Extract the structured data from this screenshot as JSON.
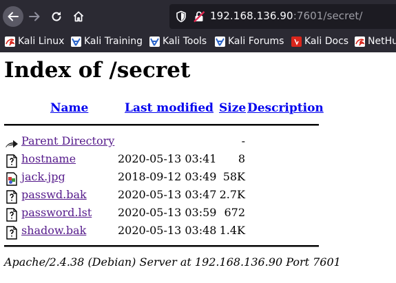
{
  "browser": {
    "url": {
      "host": "192.168.136.90",
      "rest": ":7601/secret/"
    },
    "bookmarks": [
      {
        "label": "Kali Linux",
        "icon": "kali-dragon-icon"
      },
      {
        "label": "Kali Training",
        "icon": "kali-training-icon"
      },
      {
        "label": "Kali Tools",
        "icon": "kali-tools-icon"
      },
      {
        "label": "Kali Forums",
        "icon": "kali-forums-icon"
      },
      {
        "label": "Kali Docs",
        "icon": "kali-docs-icon"
      },
      {
        "label": "NetHu",
        "icon": "nethunter-icon"
      }
    ]
  },
  "page": {
    "title": "Index of /secret",
    "columns": {
      "name": "Name",
      "modified": "Last modified",
      "size": "Size",
      "description": "Description"
    },
    "parent": {
      "name": "Parent Directory",
      "size": "-"
    },
    "files": [
      {
        "name": "hostname",
        "modified": "2020-05-13 03:41",
        "size": "8",
        "icon": "text-file-icon"
      },
      {
        "name": "jack.jpg",
        "modified": "2018-09-12 03:49",
        "size": "58K",
        "icon": "image-file-icon"
      },
      {
        "name": "passwd.bak",
        "modified": "2020-05-13 03:47",
        "size": "2.7K",
        "icon": "unknown-file-icon"
      },
      {
        "name": "password.lst",
        "modified": "2020-05-13 03:59",
        "size": "672",
        "icon": "unknown-file-icon"
      },
      {
        "name": "shadow.bak",
        "modified": "2020-05-13 03:48",
        "size": "1.4K",
        "icon": "unknown-file-icon"
      }
    ],
    "footer": "Apache/2.4.38 (Debian) Server at 192.168.136.90 Port 7601"
  },
  "colors": {
    "link": "#0000ee",
    "visited": "#551a8b",
    "chrome_bg": "#2b2a33",
    "urlbar_bg": "#1c1b22"
  }
}
